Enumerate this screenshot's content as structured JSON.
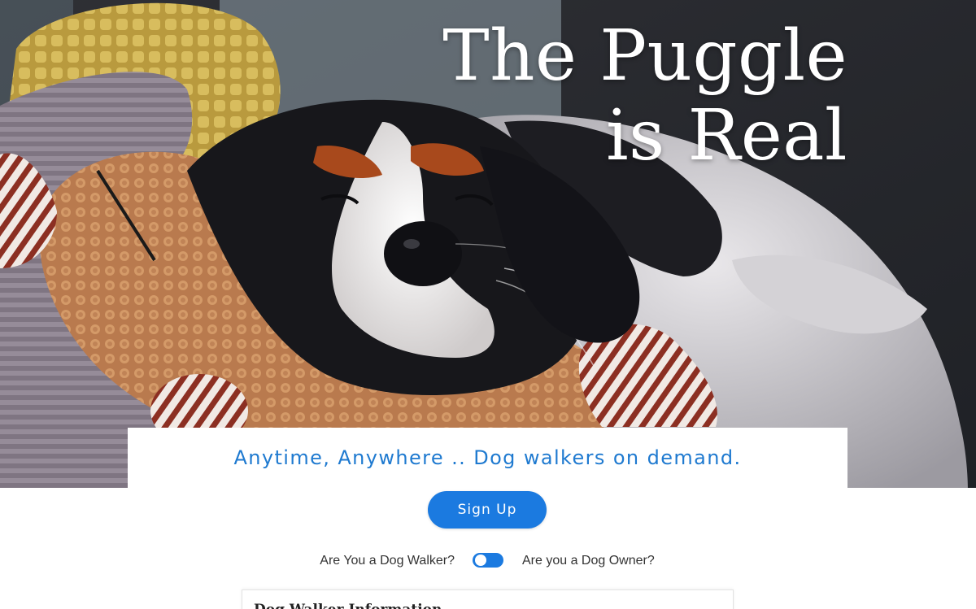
{
  "hero": {
    "title_line1": "The Puggle",
    "title_line2": "is Real",
    "image_subject": "sleeping cavalier king charles spaniel on plush toy"
  },
  "tagline": "Anytime, Anywhere .. Dog walkers on demand.",
  "signup": {
    "label": "Sign Up"
  },
  "role_toggle": {
    "left_label": "Are You a Dog Walker?",
    "right_label": "Are you a Dog Owner?",
    "on": true
  },
  "info_panel": {
    "title": "Dog Walker Information"
  },
  "colors": {
    "accent": "#1b7ae0",
    "tagline": "#1f7ad0",
    "text": "#333333",
    "background": "#ffffff"
  }
}
